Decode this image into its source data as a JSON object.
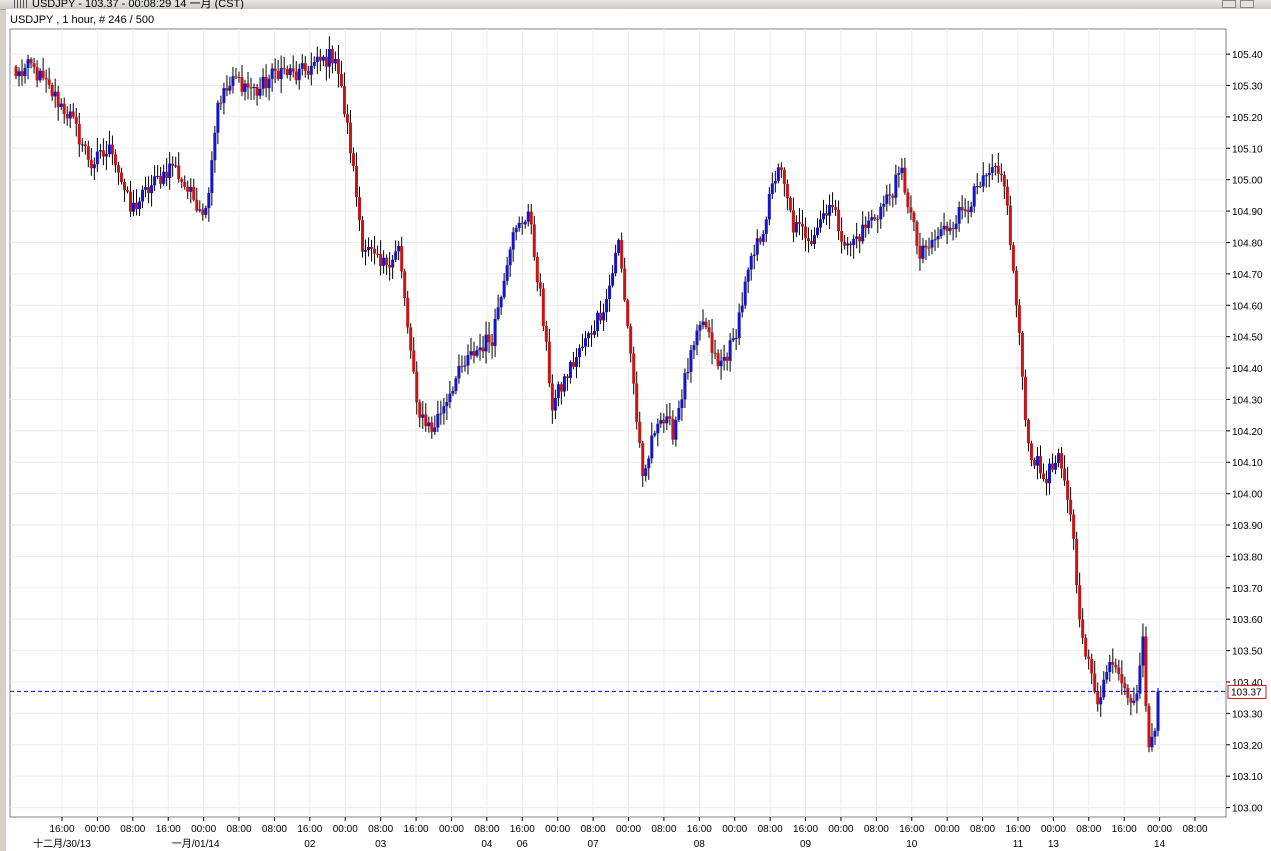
{
  "window": {
    "title": "USDJPY - 103.37 - 00:08:29  14 一月 (CST)",
    "buttons": [
      "minimize",
      "maximize"
    ]
  },
  "chart_info": "USDJPY , 1 hour, # 246 / 500",
  "colors": {
    "up": "#1414c8",
    "down": "#c81414",
    "wick": "#000000",
    "grid": "#ececec",
    "current_line": "#0000ff",
    "price_tag_border": "#d21414"
  },
  "chart_data": {
    "type": "candlestick",
    "symbol": "USDJPY",
    "timeframe": "1 hour",
    "ylim": [
      102.97,
      105.48
    ],
    "yticks": [
      "105.40",
      "105.30",
      "105.20",
      "105.10",
      "105.00",
      "104.90",
      "104.80",
      "104.70",
      "104.60",
      "104.50",
      "104.40",
      "104.30",
      "104.20",
      "104.10",
      "104.00",
      "103.90",
      "103.80",
      "103.70",
      "103.60",
      "103.50",
      "103.40",
      "103.30",
      "103.20",
      "103.10",
      "103.00"
    ],
    "current_price": "103.37",
    "xticks": [
      "16:00",
      "00:00",
      "08:00",
      "16:00",
      "00:00",
      "08:00",
      "08:00",
      "16:00",
      "00:00",
      "08:00",
      "16:00",
      "00:00",
      "08:00",
      "16:00",
      "00:00",
      "08:00",
      "00:00",
      "08:00",
      "16:00",
      "00:00",
      "08:00",
      "16:00",
      "00:00",
      "08:00",
      "16:00",
      "00:00",
      "08:00",
      "16:00",
      "00:00",
      "08:00",
      "16:00",
      "00:00",
      "08:00"
    ],
    "date_labels": [
      "十二月/30/13",
      "一月/01/14",
      "02",
      "03",
      "04",
      "06",
      "07",
      "08",
      "09",
      "10",
      "11",
      "13",
      "14"
    ],
    "keypoints": [
      [
        0,
        105.33
      ],
      [
        5,
        105.36
      ],
      [
        10,
        105.3
      ],
      [
        18,
        105.2
      ],
      [
        25,
        105.05
      ],
      [
        32,
        105.1
      ],
      [
        38,
        104.9
      ],
      [
        45,
        104.98
      ],
      [
        52,
        105.05
      ],
      [
        58,
        104.95
      ],
      [
        63,
        104.9
      ],
      [
        67,
        105.25
      ],
      [
        73,
        105.32
      ],
      [
        80,
        105.28
      ],
      [
        87,
        105.35
      ],
      [
        93,
        105.33
      ],
      [
        100,
        105.37
      ],
      [
        106,
        105.4
      ],
      [
        111,
        105.1
      ],
      [
        115,
        104.8
      ],
      [
        121,
        104.72
      ],
      [
        127,
        104.78
      ],
      [
        133,
        104.28
      ],
      [
        138,
        104.2
      ],
      [
        145,
        104.35
      ],
      [
        152,
        104.45
      ],
      [
        158,
        104.5
      ],
      [
        164,
        104.8
      ],
      [
        170,
        104.9
      ],
      [
        174,
        104.63
      ],
      [
        178,
        104.28
      ],
      [
        184,
        104.4
      ],
      [
        190,
        104.5
      ],
      [
        196,
        104.62
      ],
      [
        200,
        104.8
      ],
      [
        204,
        104.45
      ],
      [
        208,
        104.03
      ],
      [
        213,
        104.25
      ],
      [
        218,
        104.2
      ],
      [
        223,
        104.4
      ],
      [
        228,
        104.55
      ],
      [
        233,
        104.4
      ],
      [
        238,
        104.48
      ],
      [
        243,
        104.7
      ],
      [
        248,
        104.85
      ],
      [
        253,
        105.05
      ],
      [
        258,
        104.85
      ],
      [
        264,
        104.82
      ],
      [
        270,
        104.93
      ],
      [
        276,
        104.78
      ],
      [
        282,
        104.85
      ],
      [
        288,
        104.92
      ],
      [
        294,
        105.02
      ],
      [
        300,
        104.75
      ],
      [
        306,
        104.82
      ],
      [
        312,
        104.88
      ],
      [
        318,
        104.95
      ],
      [
        324,
        105.02
      ],
      [
        328,
        105.0
      ],
      [
        332,
        104.6
      ],
      [
        336,
        104.15
      ],
      [
        341,
        104.05
      ],
      [
        346,
        104.1
      ],
      [
        350,
        103.95
      ],
      [
        354,
        103.52
      ],
      [
        359,
        103.35
      ],
      [
        364,
        103.48
      ],
      [
        368,
        103.4
      ],
      [
        371,
        103.32
      ],
      [
        374,
        103.52
      ],
      [
        376,
        103.18
      ],
      [
        378,
        103.25
      ],
      [
        379,
        103.37
      ]
    ]
  }
}
